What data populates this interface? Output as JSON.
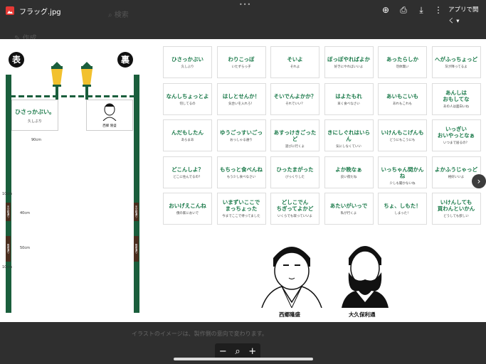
{
  "topbar": {
    "file_name": "フラッグ.jpg",
    "open_with": "アプリで開く",
    "icons": [
      "image-file-icon",
      "add-to-drive-icon",
      "print-icon",
      "download-icon",
      "more-vert-icon",
      "dropdown-icon"
    ]
  },
  "background": {
    "caption": "イラストのイメージは、製作側の意向で変わります。"
  },
  "panel": {
    "front_badge": "表",
    "back_badge": "裏",
    "front_sign_main": "ひさっかぶい。",
    "front_sign_sub": "久しぶり",
    "back_sign_name": "西郷 隆盛",
    "width_dim": "90cm",
    "dim_top": "10cm",
    "dim_mid": "40cm",
    "dim_lower": "50cm",
    "dim_bottom": "10cm",
    "vsign_a": "天文館通り",
    "vsign_b": "電車通り"
  },
  "cards": [
    {
      "main": "ひさっかぶい",
      "sub": "久しぶり"
    },
    {
      "main": "わりこっぼ",
      "sub": "いたずらっ子"
    },
    {
      "main": "そいよ",
      "sub": "それよ"
    },
    {
      "main": "ぼっぽやればよか",
      "sub": "好きにやればいいよ"
    },
    {
      "main": "あったらしか",
      "sub": "勿体無い"
    },
    {
      "main": "へがふっちょっど",
      "sub": "灰が降ってるよ"
    },
    {
      "main": "なんしちょっとよ",
      "sub": "何してるの"
    },
    {
      "main": "はしとせんか！",
      "sub": "気合いを入れろ！"
    },
    {
      "main": "そいでんよかか？",
      "sub": "それでいい？"
    },
    {
      "main": "はよたもれ",
      "sub": "早く食べなさい"
    },
    {
      "main": "あいもこいも",
      "sub": "あれもこれも"
    },
    {
      "main": "あんしは\nおもしてな",
      "sub": "あの人は面白いね"
    },
    {
      "main": "んだもしたん",
      "sub": "あらまあ"
    },
    {
      "main": "ゆうごっすいごっ",
      "sub": "おっしゃる通り"
    },
    {
      "main": "あすっけきごったど",
      "sub": "遊びに行くよ"
    },
    {
      "main": "きにしぐれはいらん",
      "sub": "気にしなくていい"
    },
    {
      "main": "いけんもこげんも",
      "sub": "どうにもこうにも"
    },
    {
      "main": "いっぎい\nおいやっとなぁ",
      "sub": "いつまで居るの？"
    },
    {
      "main": "どこんしよ？",
      "sub": "どこに住んでるの？"
    },
    {
      "main": "もちっと食べんね",
      "sub": "もう少し食べなさい"
    },
    {
      "main": "ひったまがった",
      "sub": "びっくりした"
    },
    {
      "main": "よか晩なぁ",
      "sub": "良い夜だね"
    },
    {
      "main": "いっちゃん間かんね",
      "sub": "少しも聞かないね"
    },
    {
      "main": "よかふうじゃっど",
      "sub": "格好いいよ"
    },
    {
      "main": "おいげえこんね",
      "sub": "僕の家においで"
    },
    {
      "main": "いまずいここで\nまっちょった",
      "sub": "今までここで待ってました"
    },
    {
      "main": "どしこでん\nちぎってよかど",
      "sub": "いくらでも取っていいよ"
    },
    {
      "main": "あたいがいっで",
      "sub": "私が行くよ"
    },
    {
      "main": "ちょ、しもた！",
      "sub": "しまった！"
    },
    {
      "main": "いけんしても\n買わんといかん",
      "sub": "どうしても欲しい"
    }
  ],
  "portraits": {
    "left_name": "西郷隆盛",
    "right_name": "大久保利通"
  },
  "zoom": {
    "minus": "−",
    "plus": "+"
  }
}
